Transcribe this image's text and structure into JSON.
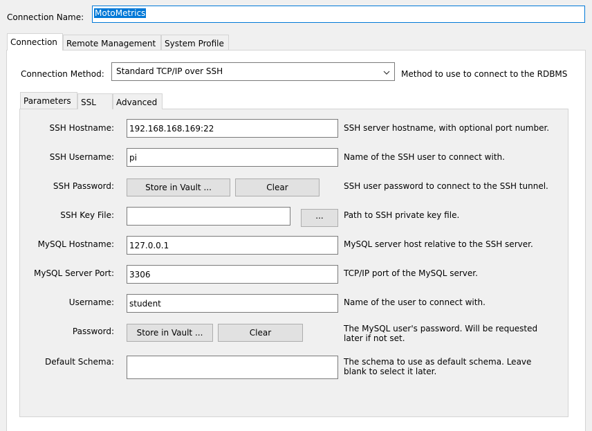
{
  "connection_name": {
    "label": "Connection Name:",
    "value": "MotoMetrics"
  },
  "outer_tabs": [
    {
      "label": "Connection"
    },
    {
      "label": "Remote Management"
    },
    {
      "label": "System Profile"
    }
  ],
  "method": {
    "label": "Connection Method:",
    "value": "Standard TCP/IP over SSH",
    "hint": "Method to use to connect to the RDBMS"
  },
  "inner_tabs": [
    {
      "label": "Parameters"
    },
    {
      "label": "SSL"
    },
    {
      "label": "Advanced"
    }
  ],
  "params": {
    "ssh_hostname": {
      "label": "SSH Hostname:",
      "value": "192.168.168.169:22",
      "hint": "SSH server hostname, with  optional port number."
    },
    "ssh_username": {
      "label": "SSH Username:",
      "value": "pi",
      "hint": "Name of the SSH user to connect with."
    },
    "ssh_password": {
      "label": "SSH Password:",
      "store": "Store in Vault ...",
      "clear": "Clear",
      "hint": "SSH user password to connect to the SSH tunnel."
    },
    "ssh_keyfile": {
      "label": "SSH Key File:",
      "value": "",
      "browse": "...",
      "hint": "Path to SSH private key file."
    },
    "mysql_hostname": {
      "label": "MySQL Hostname:",
      "value": "127.0.0.1",
      "hint": "MySQL server host relative to the SSH server."
    },
    "mysql_port": {
      "label": "MySQL Server Port:",
      "value": "3306",
      "hint": "TCP/IP port of the MySQL server."
    },
    "username": {
      "label": "Username:",
      "value": "student",
      "hint": "Name of the user to connect with."
    },
    "password": {
      "label": "Password:",
      "store": "Store in Vault ...",
      "clear": "Clear",
      "hint1": "The MySQL user's password. Will be requested",
      "hint2": "later if not set."
    },
    "default_schema": {
      "label": "Default Schema:",
      "value": "",
      "hint1": "The schema to use as default schema. Leave",
      "hint2": "blank to select it later."
    }
  },
  "colors": {
    "selection": "#0078d7",
    "focus_border": "#0078d7",
    "panel_bg": "#ffffff",
    "inner_bg": "#f0f0f0"
  }
}
